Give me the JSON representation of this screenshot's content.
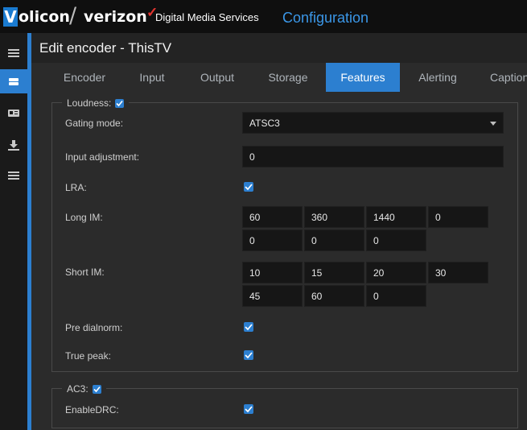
{
  "header": {
    "brand_v": "V",
    "brand_rest": "olicon",
    "brand_slash": "/",
    "brand_partner": "verizon",
    "brand_partner_mark": "✓",
    "brand_service": "Digital Media Services",
    "section": "Configuration"
  },
  "sidebar": {
    "items": [
      {
        "icon": "menu-icon"
      },
      {
        "icon": "encoder-icon",
        "active": true
      },
      {
        "icon": "id-card-icon"
      },
      {
        "icon": "download-icon"
      },
      {
        "icon": "list-icon"
      }
    ],
    "collapse_icon": "▸"
  },
  "page": {
    "title": "Edit encoder - ThisTV"
  },
  "tabs": [
    {
      "label": "Encoder"
    },
    {
      "label": "Input"
    },
    {
      "label": "Output"
    },
    {
      "label": "Storage"
    },
    {
      "label": "Features",
      "active": true
    },
    {
      "label": "Alerting"
    },
    {
      "label": "Caption"
    }
  ],
  "loudness": {
    "legend": "Loudness:",
    "enabled": true,
    "gating_mode": {
      "label": "Gating mode:",
      "value": "ATSC3"
    },
    "input_adjustment": {
      "label": "Input adjustment:",
      "value": "0"
    },
    "lra": {
      "label": "LRA:",
      "checked": true
    },
    "long_im": {
      "label": "Long IM:",
      "values": [
        "60",
        "360",
        "1440",
        "0",
        "0",
        "0",
        "0"
      ]
    },
    "short_im": {
      "label": "Short IM:",
      "values": [
        "10",
        "15",
        "20",
        "30",
        "45",
        "60",
        "0"
      ]
    },
    "pre_dialnorm": {
      "label": "Pre dialnorm:",
      "checked": true
    },
    "true_peak": {
      "label": "True peak:",
      "checked": true
    }
  },
  "ac3": {
    "legend": "AC3:",
    "enabled": true,
    "enable_drc": {
      "label": "EnableDRC:",
      "checked": true
    }
  },
  "colors": {
    "accent": "#2c7fd0",
    "config_text": "#3b97e8",
    "background": "#2b2b2b",
    "field_bg": "#161616"
  }
}
